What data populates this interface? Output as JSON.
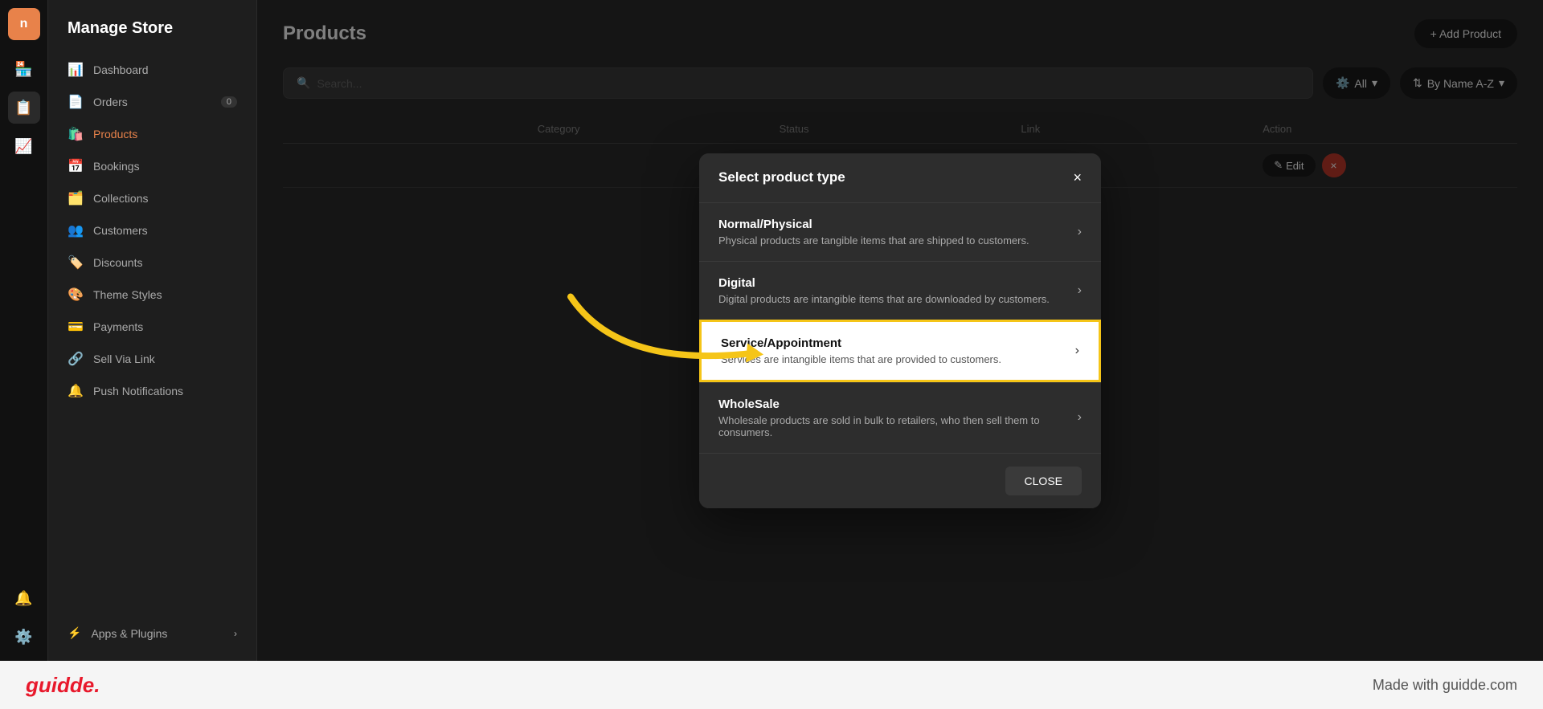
{
  "app": {
    "title": "Manage Store",
    "logo": "n"
  },
  "icon_sidebar": {
    "items": [
      {
        "id": "store",
        "icon": "🏪",
        "active": false
      },
      {
        "id": "orders",
        "icon": "📋",
        "active": true
      },
      {
        "id": "analytics",
        "icon": "📈",
        "active": false
      }
    ],
    "bottom": [
      {
        "id": "notifications",
        "icon": "🔔"
      },
      {
        "id": "settings",
        "icon": "⚙️"
      }
    ]
  },
  "nav": {
    "title": "Manage Store",
    "items": [
      {
        "id": "dashboard",
        "label": "Dashboard",
        "icon": "📊",
        "badge": null,
        "active": false
      },
      {
        "id": "orders",
        "label": "Orders",
        "icon": "📄",
        "badge": "0",
        "active": false
      },
      {
        "id": "products",
        "label": "Products",
        "icon": "🛍️",
        "badge": null,
        "active": true
      },
      {
        "id": "bookings",
        "label": "Bookings",
        "icon": "📅",
        "badge": null,
        "active": false
      },
      {
        "id": "collections",
        "label": "Collections",
        "icon": "🗂️",
        "badge": null,
        "active": false
      },
      {
        "id": "customers",
        "label": "Customers",
        "icon": "👥",
        "badge": null,
        "active": false
      },
      {
        "id": "discounts",
        "label": "Discounts",
        "icon": "🏷️",
        "badge": null,
        "active": false
      },
      {
        "id": "theme-styles",
        "label": "Theme Styles",
        "icon": "🎨",
        "badge": null,
        "active": false
      },
      {
        "id": "payments",
        "label": "Payments",
        "icon": "💳",
        "badge": null,
        "active": false
      },
      {
        "id": "sell-via-link",
        "label": "Sell Via Link",
        "icon": "🔗",
        "badge": null,
        "active": false
      },
      {
        "id": "push-notifications",
        "label": "Push Notifications",
        "icon": "🔔",
        "badge": null,
        "active": false
      }
    ],
    "bottom_item": {
      "label": "Apps & Plugins",
      "icon": "⚡"
    }
  },
  "products_page": {
    "title": "Products",
    "add_button": "+ Add Product",
    "search_placeholder": "Search...",
    "filter_button": "All",
    "sort_button": "By Name A-Z",
    "table_headers": [
      "",
      "Category",
      "Status",
      "Link",
      "Action"
    ],
    "table_row": {
      "toggle_on": true,
      "edit_label": "Edit",
      "delete_label": "×"
    }
  },
  "modal": {
    "title": "Select product type",
    "close_label": "×",
    "options": [
      {
        "id": "normal",
        "title": "Normal/Physical",
        "description": "Physical products are tangible items that are shipped to customers.",
        "highlighted": false
      },
      {
        "id": "digital",
        "title": "Digital",
        "description": "Digital products are intangible items that are downloaded by customers.",
        "highlighted": false
      },
      {
        "id": "service",
        "title": "Service/Appointment",
        "description": "Services are intangible items that are provided to customers.",
        "highlighted": true
      },
      {
        "id": "wholesale",
        "title": "WholeSale",
        "description": "Wholesale products are sold in bulk to retailers, who then sell them to consumers.",
        "highlighted": false
      }
    ],
    "close_button": "CLOSE"
  },
  "bottom_bar": {
    "logo": "guidde.",
    "made_with": "Made with guidde.com"
  }
}
